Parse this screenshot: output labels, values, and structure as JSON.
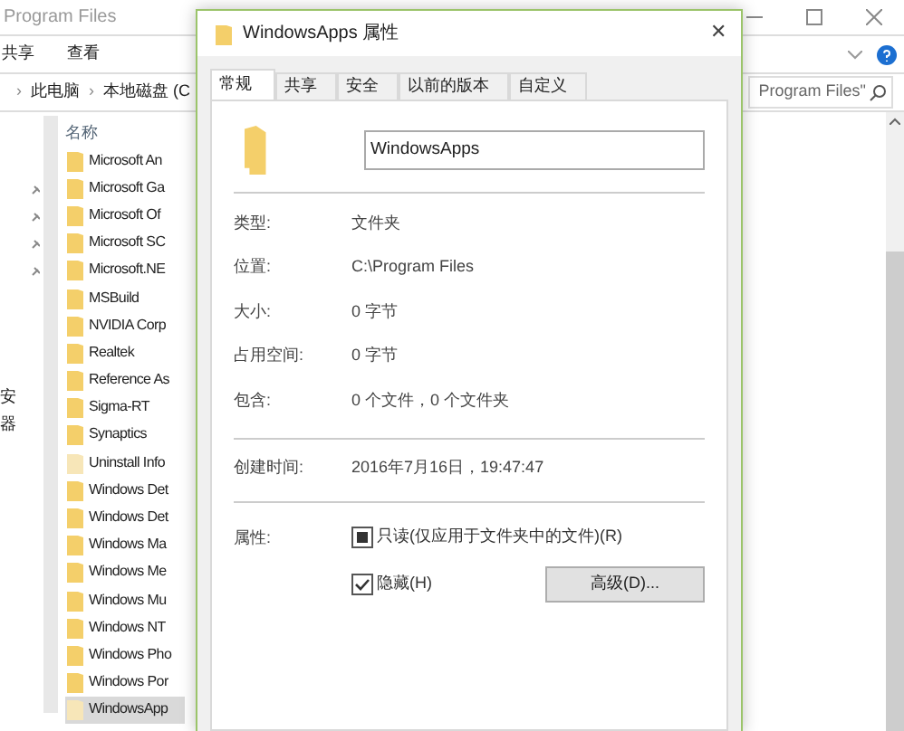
{
  "explorer": {
    "title": "Program Files",
    "ribbon_tabs": [
      "共享",
      "查看"
    ],
    "breadcrumb": [
      {
        "separator": "›",
        "label": "此电脑"
      },
      {
        "separator": "›",
        "label": "本地磁盘 (C"
      }
    ],
    "search": {
      "placeholder": "Program Files\""
    },
    "nav_fragments": [
      "安",
      "器"
    ],
    "column_header": "名称",
    "files": [
      {
        "name": "Microsoft An",
        "selected": false,
        "faded": false
      },
      {
        "name": "Microsoft Ga",
        "selected": false,
        "faded": false
      },
      {
        "name": "Microsoft Of",
        "selected": false,
        "faded": false
      },
      {
        "name": "Microsoft SC",
        "selected": false,
        "faded": false
      },
      {
        "name": "Microsoft.NE",
        "selected": false,
        "faded": false
      },
      {
        "name": "MSBuild",
        "selected": false,
        "faded": false
      },
      {
        "name": "NVIDIA Corp",
        "selected": false,
        "faded": false
      },
      {
        "name": "Realtek",
        "selected": false,
        "faded": false
      },
      {
        "name": "Reference As",
        "selected": false,
        "faded": false
      },
      {
        "name": "Sigma-RT",
        "selected": false,
        "faded": false
      },
      {
        "name": "Synaptics",
        "selected": false,
        "faded": false
      },
      {
        "name": "Uninstall Info",
        "selected": false,
        "faded": true
      },
      {
        "name": "Windows Det",
        "selected": false,
        "faded": false
      },
      {
        "name": "Windows Det",
        "selected": false,
        "faded": false
      },
      {
        "name": "Windows Ma",
        "selected": false,
        "faded": false
      },
      {
        "name": "Windows Me",
        "selected": false,
        "faded": false
      },
      {
        "name": "Windows Mu",
        "selected": false,
        "faded": false
      },
      {
        "name": "Windows NT",
        "selected": false,
        "faded": false
      },
      {
        "name": "Windows Pho",
        "selected": false,
        "faded": false
      },
      {
        "name": "Windows Por",
        "selected": false,
        "faded": false
      },
      {
        "name": "WindowsApp",
        "selected": true,
        "faded": true
      }
    ]
  },
  "dialog": {
    "title": "WindowsApps 属性",
    "close": "✕",
    "tabs": [
      {
        "label": "常规",
        "selected": true
      },
      {
        "label": "共享",
        "selected": false
      },
      {
        "label": "安全",
        "selected": false
      },
      {
        "label": "以前的版本",
        "selected": false
      },
      {
        "label": "自定义",
        "selected": false
      }
    ],
    "name_field": {
      "value": "WindowsApps"
    },
    "groups": [
      [
        {
          "label": "类型:",
          "value": "文件夹"
        },
        {
          "label": "位置:",
          "value": "C:\\Program Files"
        },
        {
          "label": "大小:",
          "value": "0 字节"
        },
        {
          "label": "占用空间:",
          "value": "0 字节"
        },
        {
          "label": "包含:",
          "value": "0 个文件，0 个文件夹"
        }
      ],
      [
        {
          "label": "创建时间:",
          "value": "2016年7月16日，19:47:47"
        }
      ]
    ],
    "attributes_label": "属性:",
    "attributes": [
      {
        "label": "只读(仅应用于文件夹中的文件)(R)",
        "indeterminate": true
      },
      {
        "label": "隐藏(H)",
        "checked": true,
        "indeterminate": false
      }
    ],
    "advanced_button": "高级(D)..."
  }
}
